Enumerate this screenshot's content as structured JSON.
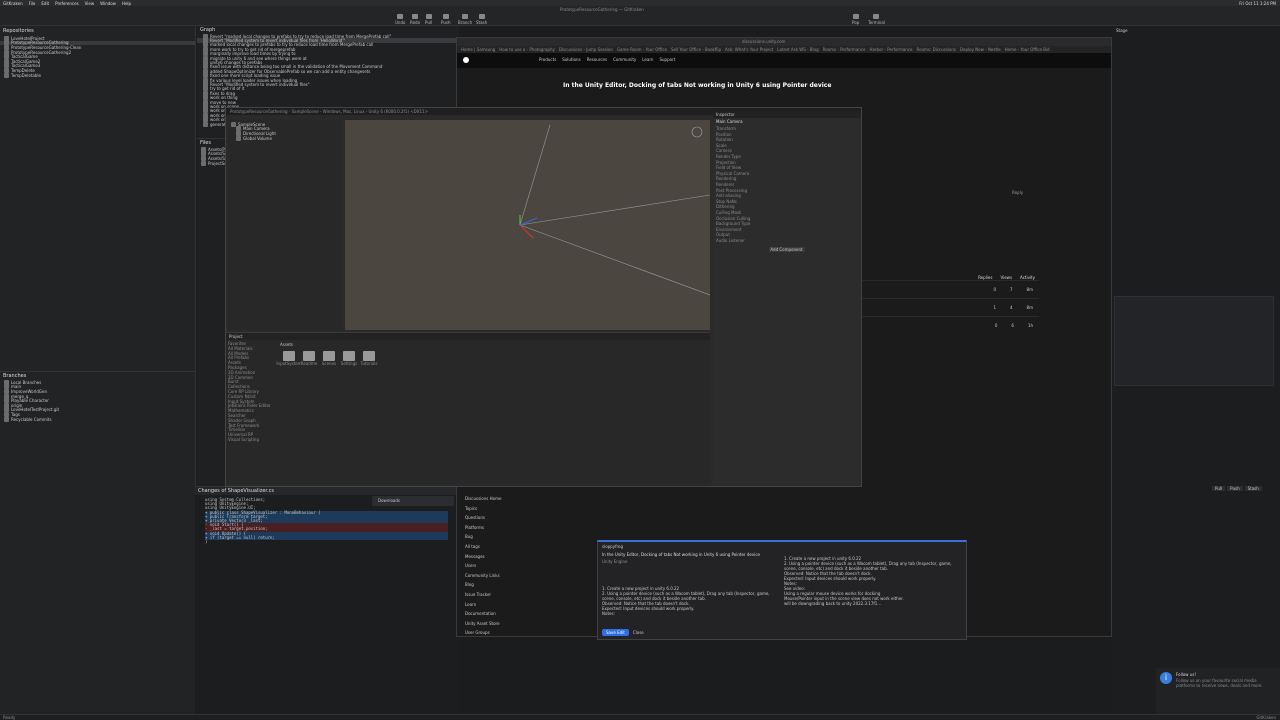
{
  "menubar": {
    "items": [
      "GitKraken",
      "File",
      "Edit",
      "Preferences",
      "View",
      "Window",
      "Help"
    ],
    "clock": "Fri Oct 11  1:24 PM"
  },
  "toolbar": {
    "buttons": [
      "Undo",
      "Redo",
      "Pull",
      "Push",
      "Branch",
      "Stash",
      "Pop",
      "Terminal"
    ],
    "title": "PrototypeResourceGathering — GitKraken"
  },
  "left": {
    "repos_header": "Repositories",
    "repos": [
      "LoveHotelProject",
      "PrototypeResourceGathering",
      "PrototypeResourceGathering-Clean",
      "PrototypeResourceGathering2",
      "TacticalGame",
      "TacticalGame2",
      "TacticalGame3",
      "TempDelete",
      "TempDeletable"
    ],
    "branches_header": "Branches",
    "branches": [
      "Local Branches",
      "main",
      "ImproveWorldGen",
      "merge_q",
      "Playable Character",
      "origin",
      "LoveHotelTestProject.git",
      "Tags",
      "Recyclable Commits"
    ]
  },
  "history": {
    "header": "Graph",
    "commits": [
      "Revert \"marked local changes to prefabs to try to reduce load time from MergePrefab call\"",
      "Revert \"Modified system to revert individual files from 'HelloWorld'\"",
      "marked local changes to prefabs to try to reduce load time from MergePrefab call",
      "more work to try to get rid of mergeprefab",
      "marginally improve load times by trying to",
      "migrate to unity 6 and see where things were at",
      "unity6 changes to prefabs",
      "fixed issue with distance being too small in the validation of the Movement Command",
      "added ShapeOptimizer for ObservablePrefab so we can add a entity changesets",
      "fixed one more script loading issue",
      "fix various level loader issues when loading",
      "Revert \"Modified system to revert individual files\"",
      "try to get rid of it",
      "fixes to drag",
      "work on thing",
      "move to new",
      "work on scene",
      "work on icons",
      "work on items",
      "work on menu",
      "generated and"
    ]
  },
  "files": {
    "header": "Files",
    "items": [
      "Assets/Prefabs",
      "Assets/Scenes",
      "Assets/Scripts",
      "ProjectSettings"
    ]
  },
  "diff": {
    "header": "Changes of ShapeVisualizer.cs",
    "lines": [
      "  using System.Collections;",
      "  using UnityEngine;",
      "  using UnityEngine.UI;",
      "+ public class ShapeVisualizer : MonoBehaviour {",
      "+   public Transform target;",
      "+   private Vector3 _last;",
      "-   void Start() {",
      "-     _last = target.position;",
      "+   void Update() {",
      "+     if (target == null) return;",
      "  }"
    ],
    "download_label": "Downloads"
  },
  "browser": {
    "url": "discussions.unity.com",
    "tabs": [
      "Home | Samsung",
      "How to use a - Photography",
      "Discussions - Jump Session",
      "Game Room - Your Office",
      "Sell Your Office - Bookflip",
      "Ask: What's Your Project",
      "Latest Ask WS - Blog",
      "Rooms - Performance",
      "Harbor - Performance",
      "Rooms: Discussions",
      "Deploy Now - Nestle",
      "Home - Your Office Bid"
    ],
    "nav": [
      "Products",
      "Solutions",
      "Resources",
      "Community",
      "Learn",
      "Support"
    ],
    "title": "In the Unity Editor, Docking of tabs Not working in Unity 6 using Pointer device",
    "sidebar": [
      "Discussions Home",
      "Topics",
      "Questions",
      "Platforms",
      "Bug",
      "All tags",
      "Messages",
      "Users",
      "Community Links",
      "Blog",
      "Issue Tracker",
      "Learn",
      "Documentation",
      "Unity Asset Store",
      "User Groups"
    ],
    "reply": "Reply",
    "table_header": [
      "Replies",
      "Views",
      "Activity"
    ],
    "rows": [
      {
        "replies": "0",
        "views": "7",
        "activity": "8m"
      },
      {
        "replies": "1",
        "views": "4",
        "activity": "8m"
      },
      {
        "replies": "0",
        "views": "6",
        "activity": "1h"
      }
    ]
  },
  "unity": {
    "title": "PrototypeResourceGathering - SampleScene - Windows, Mac, Linux - Unity 6 (6000.0.2f1) <DX11>",
    "hierarchy": [
      "SampleScene",
      "Main Camera",
      "Directional Light",
      "Global Volume"
    ],
    "inspector": {
      "header": "Inspector",
      "object": "Main Camera",
      "sections": [
        "Transform",
        "Position",
        "Rotation",
        "Scale",
        "Camera",
        "Render Type",
        "Projection",
        "Field of View",
        "Physical Camera",
        "Rendering",
        "Renderer",
        "Post Processing",
        "Anti-aliasing",
        "Stop NaNs",
        "Dithering",
        "Culling Mask",
        "Occlusion Culling",
        "Background Type",
        "Environment",
        "Output",
        "Audio Listener"
      ],
      "add_component": "Add Component"
    },
    "project": {
      "header": "Project",
      "tree": [
        "Favorites",
        "All Materials",
        "All Models",
        "All Prefabs",
        "Assets",
        "Packages",
        "2D Animation",
        "2D Common",
        "Burst",
        "Collections",
        "Core RP Library",
        "Custom NUnit",
        "Input System",
        "JetBrains Rider Editor",
        "Mathematics",
        "Searcher",
        "Shader Graph",
        "Test Framework",
        "Timeline",
        "Universal RP",
        "Visual Scripting"
      ],
      "assets": [
        "InputSystem",
        "Readme",
        "Scenes",
        "Settings",
        "Tutorials"
      ],
      "path": "Assets"
    }
  },
  "modal": {
    "user": "sloppyfrog",
    "heading": "In the Unity Editor, Docking of tabs Not working in Unity 6 using Pointer device",
    "category": "Unity Engine",
    "body_left": [
      "1. Create a new project in unity 6.0.22",
      "2. Using a pointer device (such as a Wacom tablet), Drag any tab (Inspector, game, scene, console, etc) and dock it beside another tab.",
      "",
      "Observed: Notice that the tab doesn't dock.",
      "Expected: Input devices should work properly.",
      "Notes:"
    ],
    "body_right": [
      "1. Create a new project in unity 6.0.22",
      "2. Using a pointer device (such as a Wacom tablet), Drag any tab (Inspector, game, scene, console, etc) and dock it beside another tab.",
      "",
      "Observed: Notice that the tab doesn't dock.",
      "Expected: Input devices should work properly.",
      "Notes:",
      "See video:",
      "Using a regular mouse device works for docking",
      "Mouse/Pointer input in the scene view does not work either.",
      "",
      "will be downgrading back to unity 2022.3.17f1..."
    ],
    "save": "Save Edit",
    "close": "Close"
  },
  "right": {
    "branch_label": "Stage",
    "buttons": [
      "Pull",
      "Push",
      "Stash"
    ],
    "notice_title": "Follow us!",
    "notice_body": "Follow us on your favourite social media platforms to receive news, deals and more."
  },
  "status": {
    "left": "Ready",
    "right": "GitKraken"
  }
}
